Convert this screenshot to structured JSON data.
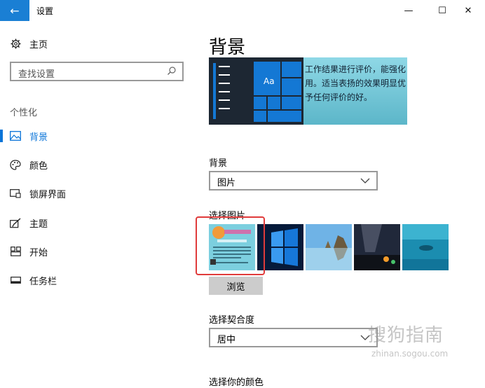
{
  "window": {
    "title": "设置",
    "back_glyph": "←",
    "minimize_glyph": "—",
    "maximize_glyph": "☐",
    "close_glyph": "✕"
  },
  "sidebar": {
    "home": "主页",
    "search_placeholder": "查找设置",
    "section": "个性化",
    "items": [
      {
        "label": "背景",
        "icon": "picture-icon",
        "active": true
      },
      {
        "label": "颜色",
        "icon": "palette-icon",
        "active": false
      },
      {
        "label": "锁屏界面",
        "icon": "lock-screen-icon",
        "active": false
      },
      {
        "label": "主题",
        "icon": "theme-brush-icon",
        "active": false
      },
      {
        "label": "开始",
        "icon": "start-grid-icon",
        "active": false
      },
      {
        "label": "任务栏",
        "icon": "taskbar-icon",
        "active": false
      }
    ]
  },
  "main": {
    "title": "背景",
    "preview": {
      "tile_label": "Aa",
      "text_lines": [
        "工作结果进行评价，能强化",
        "用。适当表扬的效果明显优",
        "予任何评价的好。"
      ]
    },
    "background_label": "背景",
    "background_value": "图片",
    "choose_picture_label": "选择图片",
    "browse_label": "浏览",
    "fit_label": "选择契合度",
    "fit_value": "居中",
    "cut_label": "选择你的颜色"
  },
  "watermark": {
    "text": "搜狗指南",
    "sub": "zhinan.sogou.com"
  },
  "colors": {
    "accent": "#0a74d8",
    "back_button": "#1a7fd4",
    "highlight_box": "#e03b3b"
  }
}
